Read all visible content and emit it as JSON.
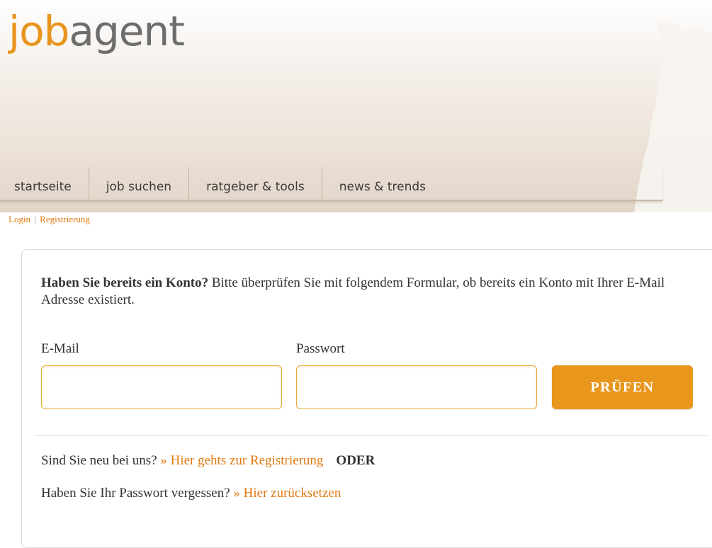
{
  "header": {
    "logo_part1": "job",
    "logo_part2": "agent"
  },
  "nav": {
    "items": [
      {
        "label": "startseite"
      },
      {
        "label": "job suchen"
      },
      {
        "label": "ratgeber & tools"
      },
      {
        "label": "news & trends"
      }
    ]
  },
  "auth_links": {
    "login": "Login",
    "separator": "|",
    "register": "Registrierung"
  },
  "form": {
    "intro_bold": "Haben Sie bereits ein Konto?",
    "intro_text": " Bitte überprüfen Sie mit folgendem Formular, ob bereits ein Konto mit Ihrer E-Mail Adresse existiert.",
    "email_label": "E-Mail",
    "email_value": "",
    "password_label": "Passwort",
    "password_value": "",
    "submit_label": "PRÜFEN"
  },
  "footer_links": {
    "new_text": "Sind Sie neu bei uns? ",
    "register_link": "» Hier gehts zur Registrierung",
    "or_text": "ODER",
    "forgot_text": "Haben Sie Ihr Passwort vergessen? ",
    "reset_link": "» Hier zurücksetzen"
  },
  "colors": {
    "accent": "#e8961c",
    "link": "#e07a12",
    "text": "#333333",
    "header_bg": "#e2d5c8"
  }
}
